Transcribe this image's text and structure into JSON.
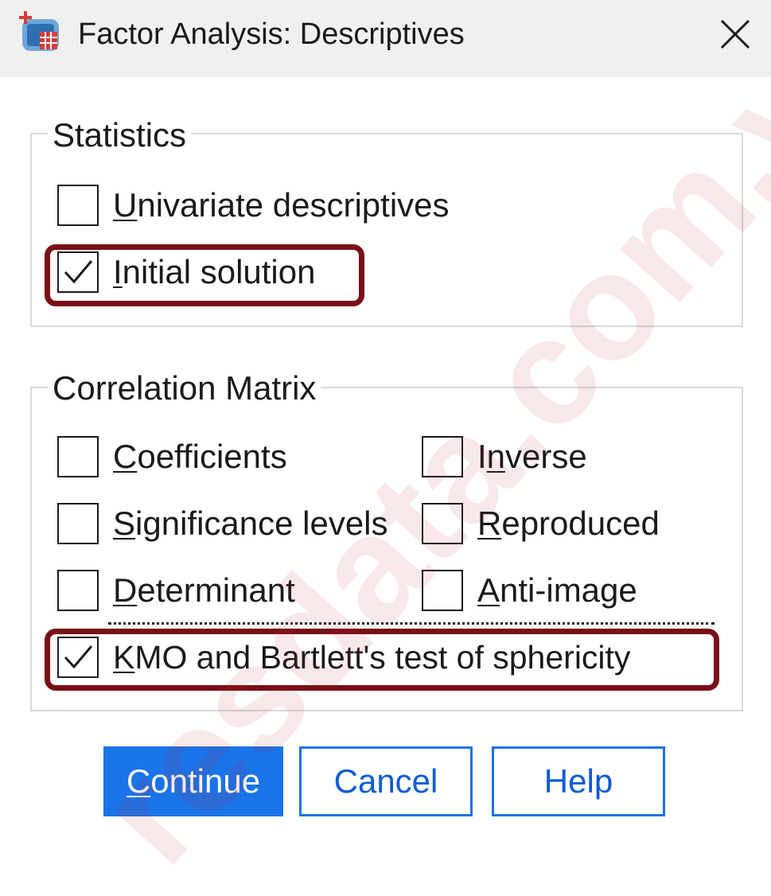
{
  "window": {
    "title": "Factor Analysis: Descriptives",
    "close_glyph": "✕"
  },
  "statistics": {
    "title": "Statistics",
    "items": [
      {
        "pre": "",
        "ul": "U",
        "post": "nivariate descriptives",
        "checked": false
      },
      {
        "pre": "",
        "ul": "I",
        "post": "nitial solution",
        "checked": true
      }
    ]
  },
  "correlation": {
    "title": "Correlation Matrix",
    "items": [
      {
        "pre": "",
        "ul": "C",
        "post": "oefficients",
        "checked": false
      },
      {
        "pre": "I",
        "ul": "n",
        "post": "verse",
        "checked": false
      },
      {
        "pre": "",
        "ul": "S",
        "post": "ignificance levels",
        "checked": false
      },
      {
        "pre": "",
        "ul": "R",
        "post": "eproduced",
        "checked": false
      },
      {
        "pre": "",
        "ul": "D",
        "post": "eterminant",
        "checked": false
      },
      {
        "pre": "",
        "ul": "A",
        "post": "nti-image",
        "checked": false
      },
      {
        "pre": "",
        "ul": "K",
        "post": "MO and Bartlett's test of sphericity",
        "checked": true
      }
    ]
  },
  "buttons": {
    "continue": {
      "ul": "C",
      "post": "ontinue"
    },
    "cancel": "Cancel",
    "help": "Help"
  },
  "watermark": "resdata.com.vn",
  "colors": {
    "primary_button": "#1a73e8",
    "highlight_box": "#7a0f17"
  }
}
